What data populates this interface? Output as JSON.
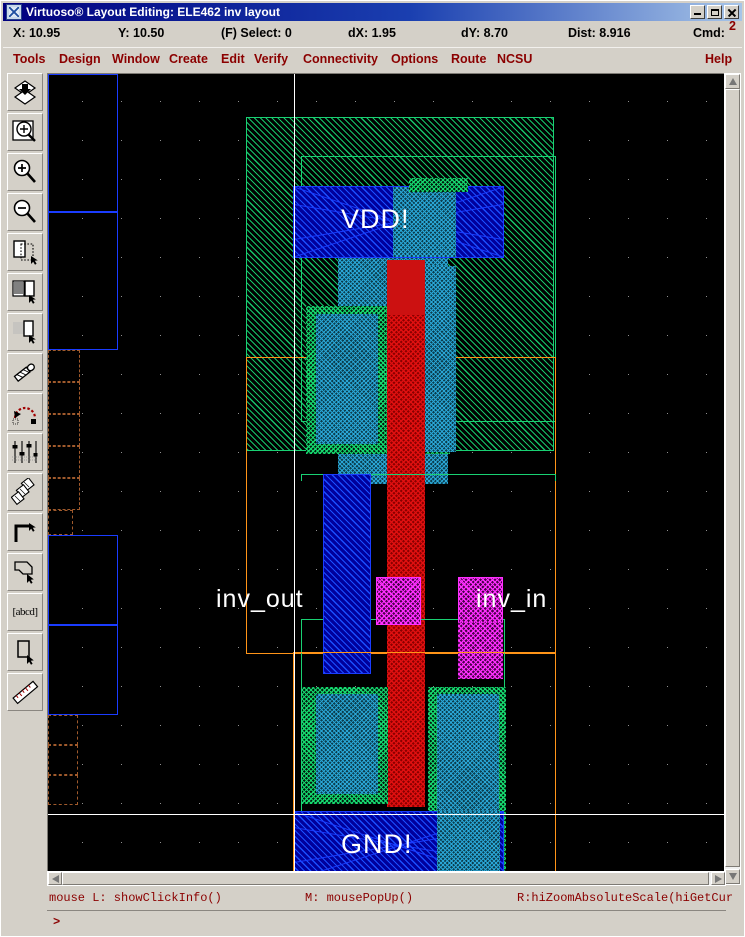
{
  "window": {
    "title": "Virtuoso® Layout Editing: ELE462 inv layout",
    "icon": "virtuoso-icon",
    "minimize_label": "",
    "maximize_label": "",
    "close_label": ""
  },
  "coordbar": {
    "x": "X:  10.95",
    "y": "Y:  10.50",
    "select": "(F) Select: 0",
    "dx": "dX:  1.95",
    "dy": "dY:  8.70",
    "dist": "Dist: 8.916",
    "cmd": "Cmd:",
    "cmd_count": "2"
  },
  "menubar": {
    "items": [
      {
        "label": "Tools"
      },
      {
        "label": "Design"
      },
      {
        "label": "Window"
      },
      {
        "label": "Create"
      },
      {
        "label": "Edit"
      },
      {
        "label": "Verify"
      },
      {
        "label": "Connectivity"
      },
      {
        "label": "Options"
      },
      {
        "label": "Route"
      },
      {
        "label": "NCSU"
      }
    ],
    "help": "Help"
  },
  "toolbar": {
    "items": [
      {
        "name": "fit-to-window-icon",
        "tooltip": "Fit"
      },
      {
        "name": "zoom-to-select-icon",
        "tooltip": "Zoom to Select"
      },
      {
        "name": "zoom-in-icon",
        "tooltip": "Zoom In"
      },
      {
        "name": "zoom-out-icon",
        "tooltip": "Zoom Out"
      },
      {
        "name": "copy-shape-icon",
        "tooltip": "Copy"
      },
      {
        "name": "stretch-icon",
        "tooltip": "Stretch"
      },
      {
        "name": "move-icon",
        "tooltip": "Move"
      },
      {
        "name": "delete-icon",
        "tooltip": "Delete"
      },
      {
        "name": "undo-icon",
        "tooltip": "Undo"
      },
      {
        "name": "properties-icon",
        "tooltip": "Properties"
      },
      {
        "name": "instance-icon",
        "tooltip": "Create Instance"
      },
      {
        "name": "path-icon",
        "tooltip": "Create Path"
      },
      {
        "name": "polygon-icon",
        "tooltip": "Create Polygon"
      },
      {
        "name": "label-icon",
        "tooltip": "Create Label",
        "glyph": "[abcd]"
      },
      {
        "name": "rectangle-icon",
        "tooltip": "Create Rectangle"
      },
      {
        "name": "ruler-icon",
        "tooltip": "Create Ruler"
      }
    ]
  },
  "layout": {
    "labels": [
      {
        "text": "VDD!",
        "name": "vdd-label"
      },
      {
        "text": "inv_out",
        "name": "inv-out-label"
      },
      {
        "text": "inv_in",
        "name": "inv-in-label"
      },
      {
        "text": "GND!",
        "name": "gnd-label"
      }
    ],
    "colors": {
      "nwell": "#19d173",
      "metal1": "#1a3cff",
      "active": "#2aa8d8",
      "nselect": "#16d96f",
      "poly": "#cc1111",
      "pin": "#ff2fff",
      "prboundary": "#ff9418",
      "background": "#000000",
      "grid": "#8f8f8f"
    }
  },
  "statusbar": {
    "mouse_left": "mouse L: showClickInfo()",
    "mouse_middle": "M: mousePopUp()",
    "mouse_right": "R:hiZoomAbsoluteScale(hiGetCur",
    "prompt": ">"
  }
}
